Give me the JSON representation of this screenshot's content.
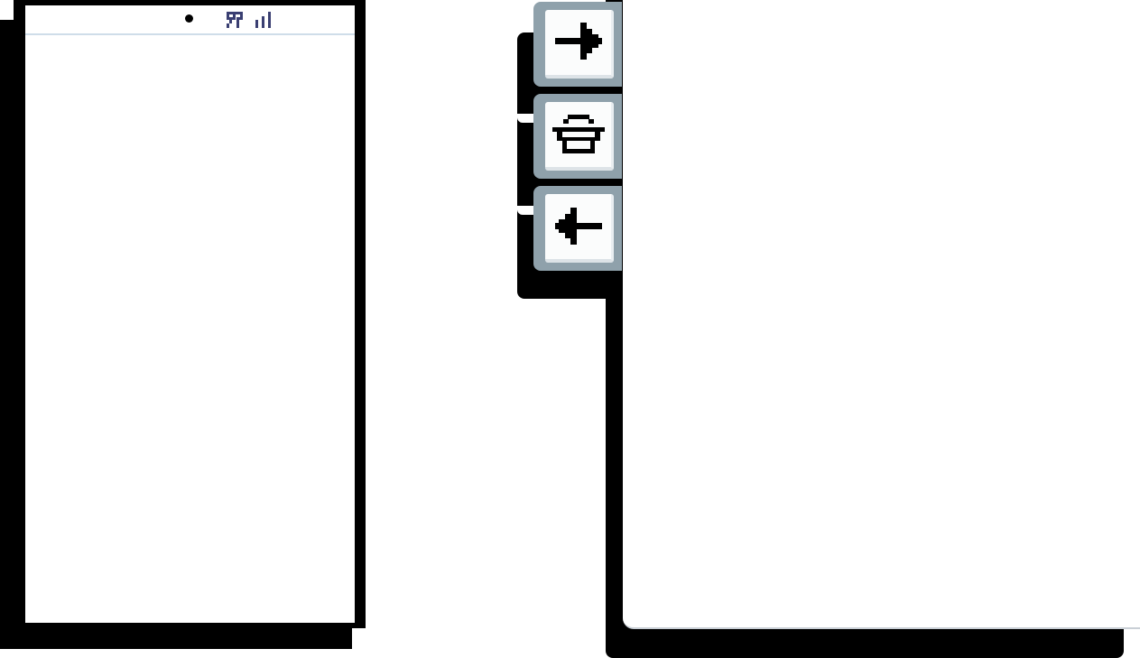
{
  "phone": {
    "status_bar": {
      "icons": [
        "dot-indicator-icon",
        "network-icon",
        "signal-bars-icon"
      ]
    }
  },
  "toolbar": {
    "buttons": [
      {
        "name": "forward-button",
        "icon": "arrow-right-icon"
      },
      {
        "name": "print-button",
        "icon": "printer-icon"
      },
      {
        "name": "back-button",
        "icon": "arrow-left-icon"
      }
    ]
  },
  "colors": {
    "frame": "#000000",
    "button_border": "#8fa1ab",
    "button_face": "#fbfcfc",
    "status_divider": "#cfdde9",
    "status_icon": "#3a3f72"
  }
}
